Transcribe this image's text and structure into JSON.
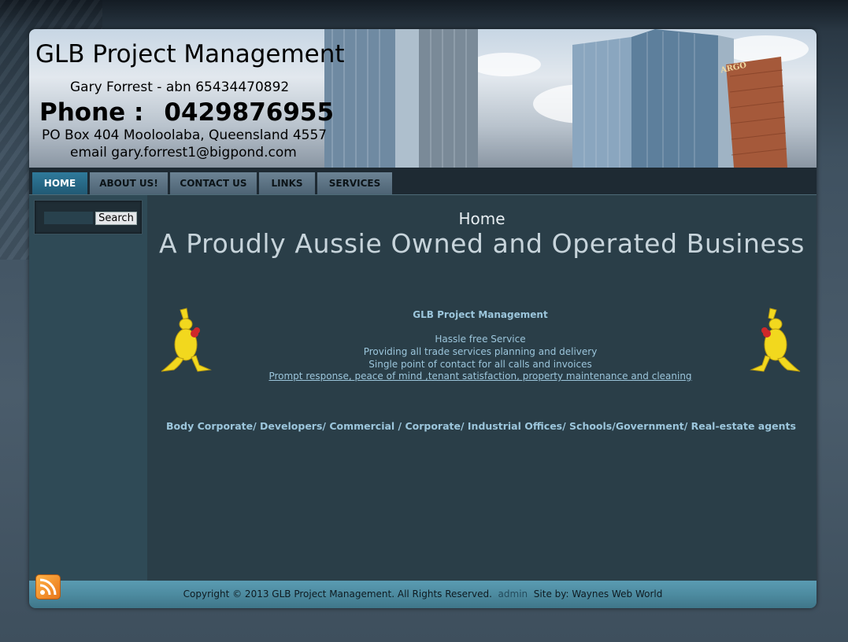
{
  "header": {
    "title": "GLB Project Management",
    "abn_line": "Gary Forrest  -  abn 65434470892",
    "phone_label": "Phone :",
    "phone_number": "0429876955",
    "address": "PO Box 404 Mooloolaba, Queensland 4557",
    "email": "email gary.forrest1@bigpond.com",
    "sign_text": "ARGO"
  },
  "nav": {
    "items": [
      {
        "label": "HOME",
        "active": true
      },
      {
        "label": "ABOUT US!"
      },
      {
        "label": "CONTACT US"
      },
      {
        "label": "LINKS"
      },
      {
        "label": "SERVICES"
      }
    ]
  },
  "sidebar": {
    "search_value": "",
    "search_button": "Search"
  },
  "content": {
    "page_title": "Home",
    "heading": "A Proudly Aussie Owned and Operated Business",
    "company_name": "GLB Project Management",
    "lines": [
      "Hassle free Service",
      "Providing all trade services planning and delivery",
      "Single point of contact for all calls and invoices",
      "Prompt response, peace of mind ,tenant satisfaction, property maintenance and cleaning"
    ],
    "sectors": "Body Corporate/ Developers/ Commercial / Corporate/ Industrial Offices/ Schools/Government/ Real-estate agents"
  },
  "footer": {
    "copyright": "Copyright © 2013 GLB Project Management. All Rights Reserved.",
    "admin": "admin",
    "site_by": "Site by: Waynes Web World"
  },
  "colors": {
    "accent_text": "#9cc6dc",
    "nav_active": "#2f7a9b",
    "footer": "#4d8ba0",
    "content_bg": "#2a3e48"
  }
}
